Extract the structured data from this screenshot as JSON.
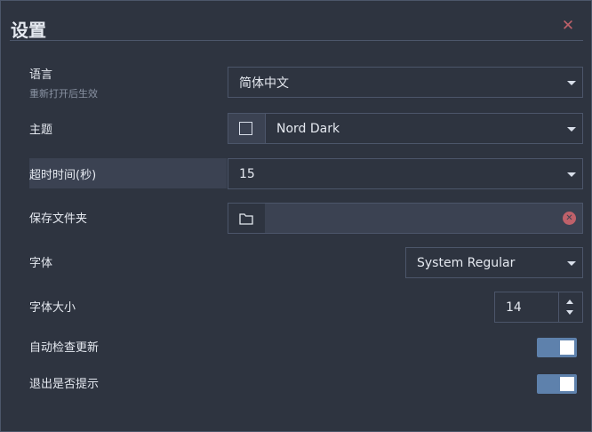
{
  "dialog": {
    "title": "设置",
    "close_icon": "close-icon"
  },
  "settings": {
    "language": {
      "label": "语言",
      "hint": "重新打开后生效",
      "value": "简体中文"
    },
    "theme": {
      "label": "主题",
      "value": "Nord Dark"
    },
    "timeout": {
      "label": "超时时间(秒)",
      "value": "15"
    },
    "save_folder": {
      "label": "保存文件夹",
      "value": "",
      "folder_icon": "folder-icon",
      "clear_icon": "clear-icon"
    },
    "font": {
      "label": "字体",
      "value": "System Regular"
    },
    "font_size": {
      "label": "字体大小",
      "value": "14"
    },
    "auto_update": {
      "label": "自动检查更新",
      "enabled": true
    },
    "exit_prompt": {
      "label": "退出是否提示",
      "enabled": true
    }
  },
  "colors": {
    "background": "#2e3440",
    "field_bg": "#3b4252",
    "border": "#4c566a",
    "accent": "#5e81ac",
    "danger": "#bf616a"
  }
}
